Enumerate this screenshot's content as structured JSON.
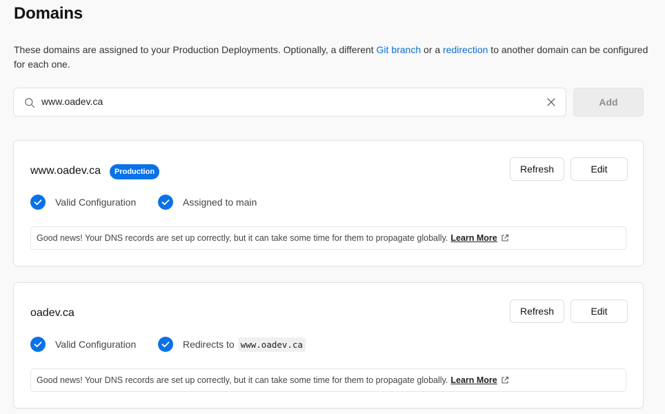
{
  "page": {
    "title": "Domains",
    "description_prefix": "These domains are assigned to your Production Deployments. Optionally, a different ",
    "git_branch_link": "Git branch",
    "description_middle": " or a ",
    "redirection_link": "redirection",
    "description_suffix": " to another domain can be configured for each one."
  },
  "search": {
    "value": "www.oadev.ca",
    "add_label": "Add"
  },
  "domains": [
    {
      "name": "www.oadev.ca",
      "badge": "Production",
      "refresh_label": "Refresh",
      "edit_label": "Edit",
      "status_1": "Valid Configuration",
      "status_2": "Assigned to main",
      "notice": "Good news! Your DNS records are set up correctly, but it can take some time for them to propagate globally.",
      "learn_more": "Learn More"
    },
    {
      "name": "oadev.ca",
      "refresh_label": "Refresh",
      "edit_label": "Edit",
      "status_1": "Valid Configuration",
      "status_2": "Redirects to",
      "redirect_target": "www.oadev.ca",
      "notice": "Good news! Your DNS records are set up correctly, but it can take some time for them to propagate globally.",
      "learn_more": "Learn More"
    }
  ],
  "colors": {
    "accent": "#0a72e8",
    "link": "#0a6fd6"
  }
}
